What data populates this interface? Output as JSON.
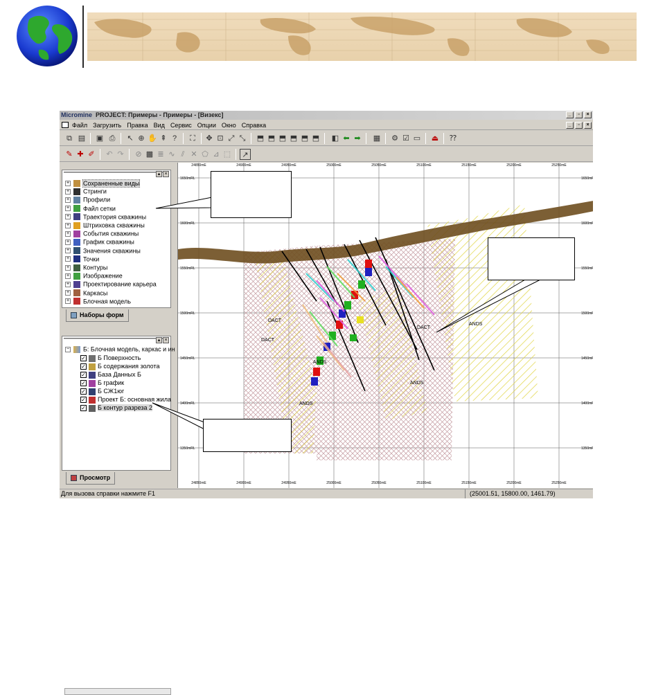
{
  "window": {
    "brand": "Micromine",
    "title": "PROJECT: Примеры - Примеры - [Визекс]"
  },
  "menu": {
    "items": [
      "Файл",
      "Загрузить",
      "Правка",
      "Вид",
      "Сервис",
      "Опции",
      "Окно",
      "Справка"
    ]
  },
  "forms_tree": {
    "items": [
      {
        "label": "Сохраненные виды",
        "icon": "saved-views-icon",
        "selected": true
      },
      {
        "label": "Стринги",
        "icon": "strings-icon"
      },
      {
        "label": "Профили",
        "icon": "profiles-icon"
      },
      {
        "label": "Файл сетки",
        "icon": "grid-file-icon"
      },
      {
        "label": "Траектория скважины",
        "icon": "drillhole-trace-icon"
      },
      {
        "label": "Штриховка скважины",
        "icon": "drillhole-hatch-icon"
      },
      {
        "label": "События скважины",
        "icon": "drillhole-events-icon"
      },
      {
        "label": "График скважины",
        "icon": "drillhole-graph-icon"
      },
      {
        "label": "Значения скважины",
        "icon": "drillhole-values-icon"
      },
      {
        "label": "Точки",
        "icon": "points-icon"
      },
      {
        "label": "Контуры",
        "icon": "contours-icon"
      },
      {
        "label": "Изображение",
        "icon": "image-icon"
      },
      {
        "label": "Проектирование карьера",
        "icon": "pit-design-icon"
      },
      {
        "label": "Каркасы",
        "icon": "wireframes-icon"
      },
      {
        "label": "Блочная модель",
        "icon": "block-model-icon"
      }
    ],
    "tab_label": "Наборы форм"
  },
  "display_tree": {
    "root_label": "Б: Блочная модель, каркас и ин",
    "items": [
      {
        "label": "Б Поверхность",
        "checked": true
      },
      {
        "label": "Б содержания золота",
        "checked": true
      },
      {
        "label": "База Данных Б",
        "checked": true
      },
      {
        "label": "Б график",
        "checked": true
      },
      {
        "label": "Б СЖ1юг",
        "checked": true
      },
      {
        "label": "Проект Б: основная жила",
        "checked": true
      },
      {
        "label": "Б контур разреза 2",
        "checked": true
      }
    ],
    "tab_label": "Просмотр"
  },
  "map": {
    "x_labels_top": [
      "24850mE",
      "24900mE",
      "24950mE",
      "25000mE",
      "25050mE",
      "25100mE",
      "25150mE",
      "25200mE",
      "25250mE"
    ],
    "x_labels_bottom": [
      "24850mE",
      "24900mE",
      "24950mE",
      "25000mE",
      "25050mE",
      "25100mE",
      "25150mE",
      "25200mE",
      "25250mE"
    ],
    "y_labels": [
      "1650mRL",
      "1600mRL",
      "1550mRL",
      "1500mRL",
      "1450mRL",
      "1400mRL",
      "1350mRL"
    ],
    "lithology_labels": [
      "DACT",
      "ANDS",
      "DACT",
      "DACT",
      "ANDS",
      "ANDS",
      "ANDS"
    ],
    "colors": {
      "surface": "#7a5a28",
      "hatch_yellow": "#e6dc4a",
      "hatch_pink": "#c89aa0"
    }
  },
  "status": {
    "help_text": "Для вызова справки нажмите F1",
    "coordinates": "(25001.51, 15800.00, 1461.79)"
  }
}
